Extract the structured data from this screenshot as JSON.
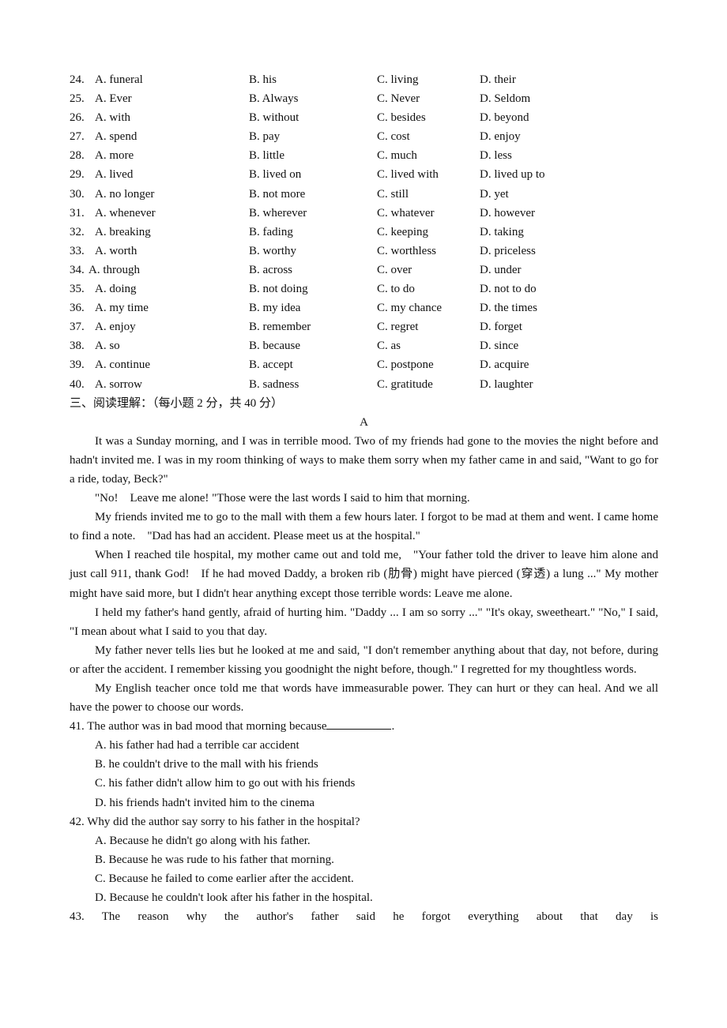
{
  "cloze_options": [
    {
      "n": "24.",
      "a": "A. funeral",
      "b": "B. his",
      "c": "C. living",
      "d": "D. their"
    },
    {
      "n": "25.",
      "a": "A. Ever",
      "b": "B. Always",
      "c": "C. Never",
      "d": "D. Seldom"
    },
    {
      "n": "26.",
      "a": "A. with",
      "b": "B. without",
      "c": "C. besides",
      "d": "D. beyond"
    },
    {
      "n": "27.",
      "a": "A. spend",
      "b": "B. pay",
      "c": "C. cost",
      "d": "D. enjoy"
    },
    {
      "n": "28.",
      "a": "A. more",
      "b": "B. little",
      "c": "C. much",
      "d": "D. less"
    },
    {
      "n": "29.",
      "a": "A. lived",
      "b": "B. lived on",
      "c": "C. lived with",
      "d": "D. lived up to"
    },
    {
      "n": "30.",
      "a": "A. no longer",
      "b": "B. not more",
      "c": "C. still",
      "d": "D. yet"
    },
    {
      "n": "31.",
      "a": "A. whenever",
      "b": "B. wherever",
      "c": "C. whatever",
      "d": "D. however"
    },
    {
      "n": "32.",
      "a": "A. breaking",
      "b": "B. fading",
      "c": "C. keeping",
      "d": "D. taking"
    },
    {
      "n": "33.",
      "a": "A. worth",
      "b": "B. worthy",
      "c": "C. worthless",
      "d": "D. priceless"
    },
    {
      "n": "34.",
      "a": "A. through",
      "b": "B. across",
      "c": "C. over",
      "d": "D. under"
    },
    {
      "n": "35.",
      "a": "A. doing",
      "b": "B. not doing",
      "c": "C. to do",
      "d": "D. not to do"
    },
    {
      "n": "36.",
      "a": "A. my time",
      "b": "B. my idea",
      "c": "C. my chance",
      "d": "D. the times"
    },
    {
      "n": "37.",
      "a": "A. enjoy",
      "b": "B. remember",
      "c": "C. regret",
      "d": "D. forget"
    },
    {
      "n": "38.",
      "a": "A. so",
      "b": "B. because",
      "c": "C. as",
      "d": "D. since"
    },
    {
      "n": "39.",
      "a": "A. continue",
      "b": "B. accept",
      "c": "C. postpone",
      "d": "D. acquire"
    },
    {
      "n": "40.",
      "a": "A. sorrow",
      "b": "B. sadness",
      "c": "C. gratitude",
      "d": "D. laughter"
    }
  ],
  "section": {
    "title": "三、阅读理解：（每小题 2 分，共 40 分）",
    "passage_label": "A"
  },
  "passage": [
    "It was a Sunday morning, and I was in terrible mood. Two of my friends had gone to the movies the night before and hadn't invited me. I was in my room thinking of ways to make them sorry when my father came in and said, \"Want to go for a ride, today, Beck?\"",
    "\"No! Leave me alone! \"Those were the last words I said to him that morning.",
    "My friends invited me to go to the mall with them a few hours later. I forgot to be mad at them and went. I came home to find a note. \"Dad has had an accident. Please meet us at the hospital.\"",
    "When I reached tile hospital, my mother came out and told me, \"Your father told the driver to leave him alone and just call 911, thank God! If he had moved Daddy, a broken rib (肋骨) might have pierced (穿透) a lung ...\" My mother might have said more, but I didn't hear anything except those terrible words: Leave me alone.",
    "I held my father's hand gently, afraid of hurting him. \"Daddy ... I am so sorry ...\" \"It's okay, sweetheart.\" \"No,\" I said, \"I mean about what I said to you that day.",
    "My father never tells lies but he looked at me and said, \"I don't remember anything about that day, not before, during or after the accident. I remember kissing you goodnight the night before, though.\" I regretted for my thoughtless words.",
    "My English teacher once told me that words have immeasurable power. They can hurt or they can heal. And we all have the power to choose our words."
  ],
  "questions": {
    "q41": {
      "stem": "41. The author was in bad mood that morning because",
      "end": ".",
      "choices": [
        "A. his father had had a terrible car accident",
        "B. he couldn't drive to the mall with his friends",
        "C. his father didn't allow him to go out with his friends",
        "D. his friends hadn't invited him to the cinema"
      ]
    },
    "q42": {
      "stem": "42. Why did the author say sorry to his father in the hospital?",
      "choices": [
        "A. Because he didn't go along with his father.",
        "B. Because he was rude to his father that morning.",
        "C. Because he failed to come earlier after the accident.",
        "D. Because he couldn't look after his father in the hospital."
      ]
    },
    "q43": {
      "stem": "43. The reason why the author's father said he forgot everything about that day is"
    }
  }
}
